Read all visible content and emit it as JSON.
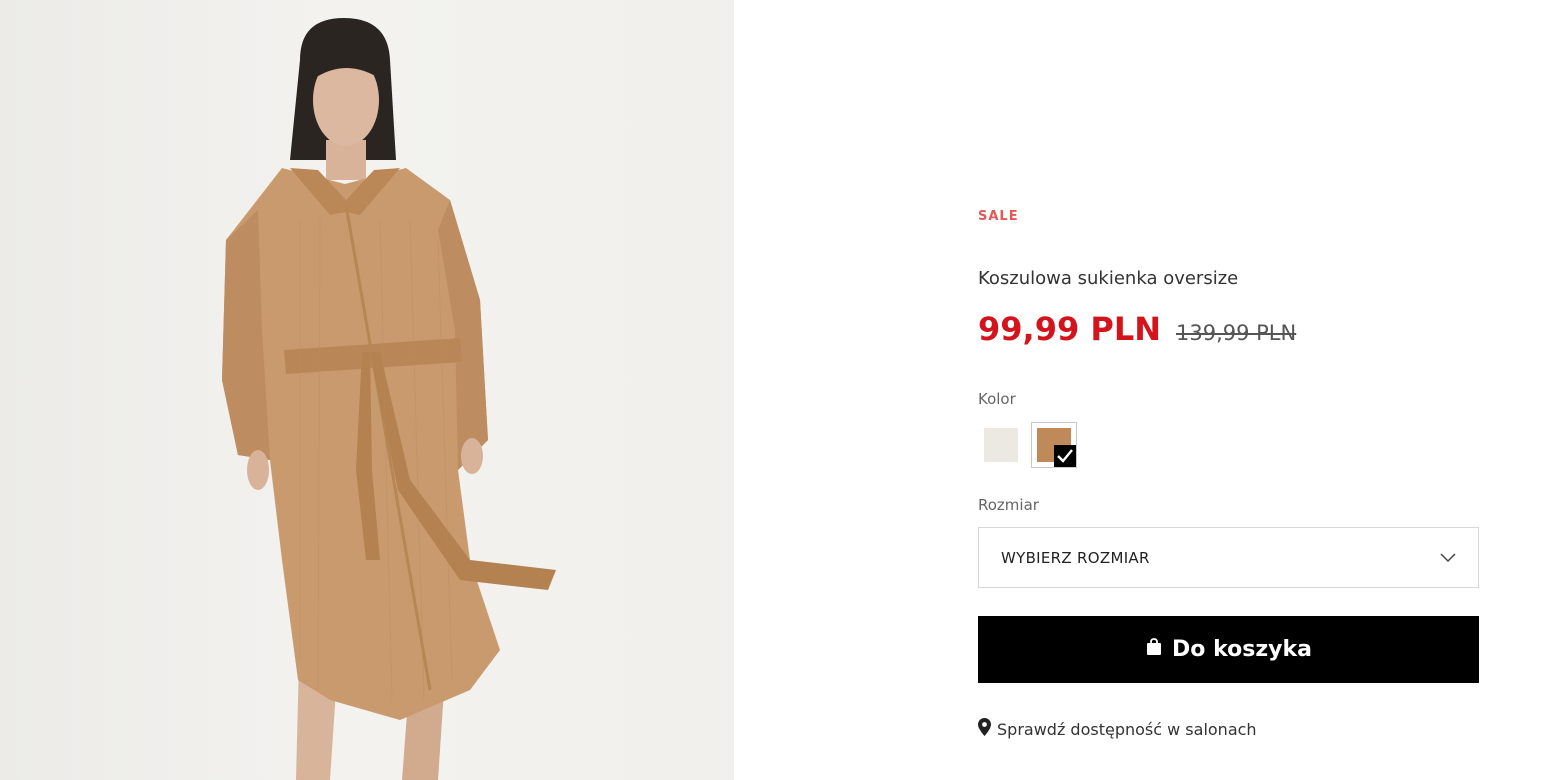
{
  "product": {
    "badge": "SALE",
    "name": "Koszulowa sukienka oversize",
    "price_current": "99,99 PLN",
    "price_old": "139,99 PLN",
    "image_alt": "product-photo"
  },
  "color": {
    "label": "Kolor",
    "options": [
      {
        "name": "white-swatch",
        "hex": "#ece9e3",
        "selected": false
      },
      {
        "name": "camel-swatch",
        "hex": "#c0895a",
        "selected": true
      }
    ]
  },
  "size": {
    "label": "Rozmiar",
    "selected_value": "WYBIERZ ROZMIAR"
  },
  "cart": {
    "add_label": "Do koszyka"
  },
  "stores": {
    "link_label": "Sprawdź dostępność w salonach"
  },
  "colors": {
    "sale_red": "#d3141c",
    "badge_red": "#e05a56",
    "button_black": "#000000"
  }
}
